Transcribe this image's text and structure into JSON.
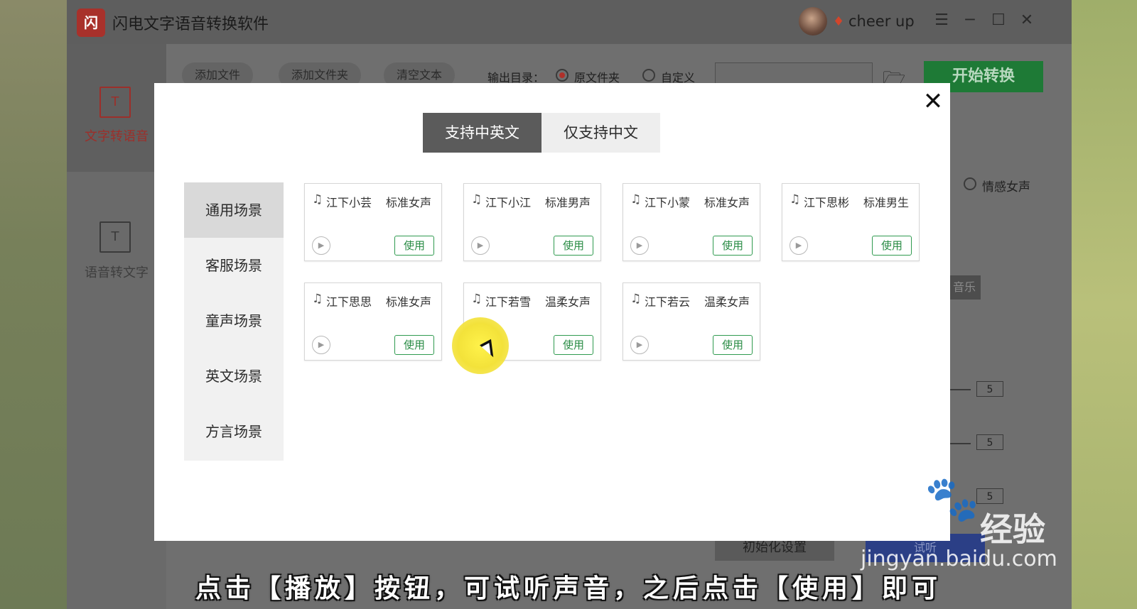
{
  "app": {
    "title": "闪电文字语音转换软件",
    "logo_text": "闪",
    "user_name": "cheer up"
  },
  "window_controls": {
    "menu": "☰",
    "minimize": "─",
    "maximize": "☐",
    "close": "✕"
  },
  "nav": [
    {
      "label": "文字转语音",
      "icon": "text-to-speech-icon",
      "active": true
    },
    {
      "label": "语音转文字",
      "icon": "speech-to-text-icon",
      "active": false
    }
  ],
  "toolbar": {
    "add_file": "添加文件",
    "add_folder": "添加文件夹",
    "clear_text": "清空文本",
    "output_label": "输出目录：",
    "option_original": "原文件夹",
    "option_custom": "自定义",
    "start": "开始转换"
  },
  "background_fragments": {
    "emotional_female": "情感女声",
    "music": "音乐",
    "values": [
      "5",
      "5",
      "5"
    ],
    "init_settings": "初始化设置",
    "trial": "试听"
  },
  "modal": {
    "close": "✕",
    "tabs": [
      {
        "label": "支持中英文",
        "active": true
      },
      {
        "label": "仅支持中文",
        "active": false
      }
    ],
    "scenes": [
      {
        "label": "通用场景",
        "active": true
      },
      {
        "label": "客服场景",
        "active": false
      },
      {
        "label": "童声场景",
        "active": false
      },
      {
        "label": "英文场景",
        "active": false
      },
      {
        "label": "方言场景",
        "active": false
      }
    ],
    "use_label": "使用",
    "voices": [
      {
        "name": "江下小芸",
        "type": "标准女声"
      },
      {
        "name": "江下小江",
        "type": "标准男声"
      },
      {
        "name": "江下小蒙",
        "type": "标准女声"
      },
      {
        "name": "江下思彬",
        "type": "标准男生"
      },
      {
        "name": "江下思思",
        "type": "标准女声"
      },
      {
        "name": "江下若雪",
        "type": "温柔女声"
      },
      {
        "name": "江下若云",
        "type": "温柔女声"
      }
    ]
  },
  "watermark": {
    "brand": "Bai",
    "product": "经验",
    "url": "jingyan.baidu.com"
  },
  "subtitle": "点击【播放】按钮，可试听声音，之后点击【使用】即可"
}
